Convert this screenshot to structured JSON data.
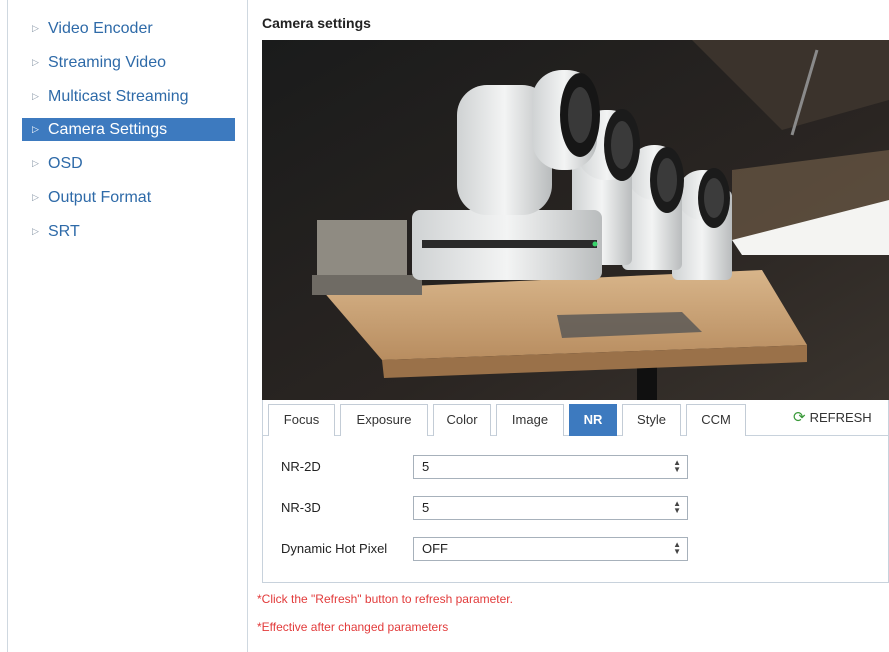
{
  "sidebar": {
    "items": [
      {
        "label": "Video Encoder",
        "active": false
      },
      {
        "label": "Streaming Video",
        "active": false
      },
      {
        "label": "Multicast Streaming",
        "active": false
      },
      {
        "label": "Camera Settings",
        "active": true
      },
      {
        "label": "OSD",
        "active": false
      },
      {
        "label": "Output Format",
        "active": false
      },
      {
        "label": "SRT",
        "active": false
      }
    ]
  },
  "main": {
    "title": "Camera settings",
    "tabs": [
      {
        "label": "Focus",
        "active": false
      },
      {
        "label": "Exposure",
        "active": false
      },
      {
        "label": "Color",
        "active": false
      },
      {
        "label": "Image",
        "active": false
      },
      {
        "label": "NR",
        "active": true
      },
      {
        "label": "Style",
        "active": false
      },
      {
        "label": "CCM",
        "active": false
      }
    ],
    "refresh_label": "REFRESH",
    "fields": [
      {
        "label": "NR-2D",
        "value": "5"
      },
      {
        "label": "NR-3D",
        "value": "5"
      },
      {
        "label": "Dynamic Hot Pixel",
        "value": "OFF"
      }
    ],
    "notes": [
      "*Click the \"Refresh\" button to refresh parameter.",
      "*Effective after changed parameters"
    ]
  },
  "colors": {
    "accent": "#3d7abf",
    "link": "#2e6aa8",
    "note": "#e23b3b"
  },
  "icons": {
    "sidebar_bullet": "triangle-right-icon",
    "refresh": "refresh-icon",
    "select": "updown-arrows-icon"
  }
}
